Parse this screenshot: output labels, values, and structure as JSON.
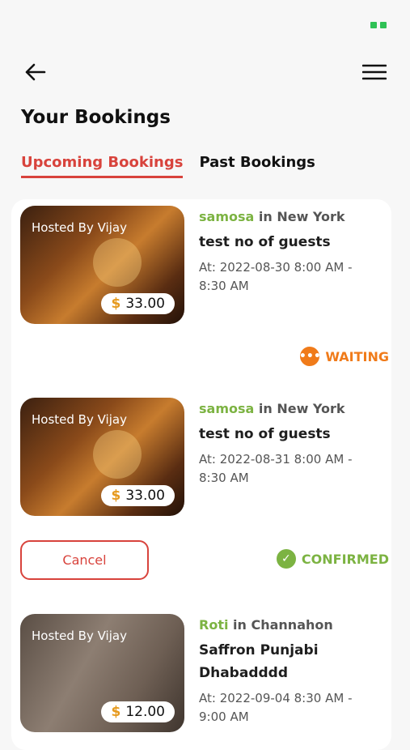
{
  "status_bar": {
    "battery_color": "#2fc155"
  },
  "header": {
    "back_icon": "arrow-left-icon",
    "menu_icon": "hamburger-menu-icon"
  },
  "page_title": "Your Bookings",
  "tabs": [
    {
      "label": "Upcoming Bookings",
      "active": true
    },
    {
      "label": "Past Bookings",
      "active": false
    }
  ],
  "bookings": [
    {
      "host": "Hosted By Vijay",
      "currency": "$",
      "price": "33.00",
      "dish": "samosa",
      "location": "in New York",
      "event": "test no of guests",
      "time_line1": "At: 2022-08-30 8:00 AM -",
      "time_line2": "8:30 AM",
      "status": "WAITING"
    },
    {
      "host": "Hosted By Vijay",
      "currency": "$",
      "price": "33.00",
      "dish": "samosa",
      "location": "in New York",
      "event": "test no of guests",
      "time_line1": "At: 2022-08-31 8:00 AM -",
      "time_line2": "8:30 AM",
      "status": "CONFIRMED",
      "action": "Cancel"
    },
    {
      "host": "Hosted By Vijay",
      "currency": "$",
      "price": "12.00",
      "dish": "Roti",
      "location": "in Channahon",
      "event_line1": "Saffron Punjabi",
      "event_line2": "Dhabadddd",
      "time_line1": "At: 2022-09-04 8:30 AM -",
      "time_line2": "9:00 AM"
    }
  ],
  "colors": {
    "accent": "#d8433c",
    "dish": "#7cb342",
    "waiting": "#f07b1a",
    "confirmed": "#7cb342",
    "price_symbol": "#e69a1e"
  }
}
